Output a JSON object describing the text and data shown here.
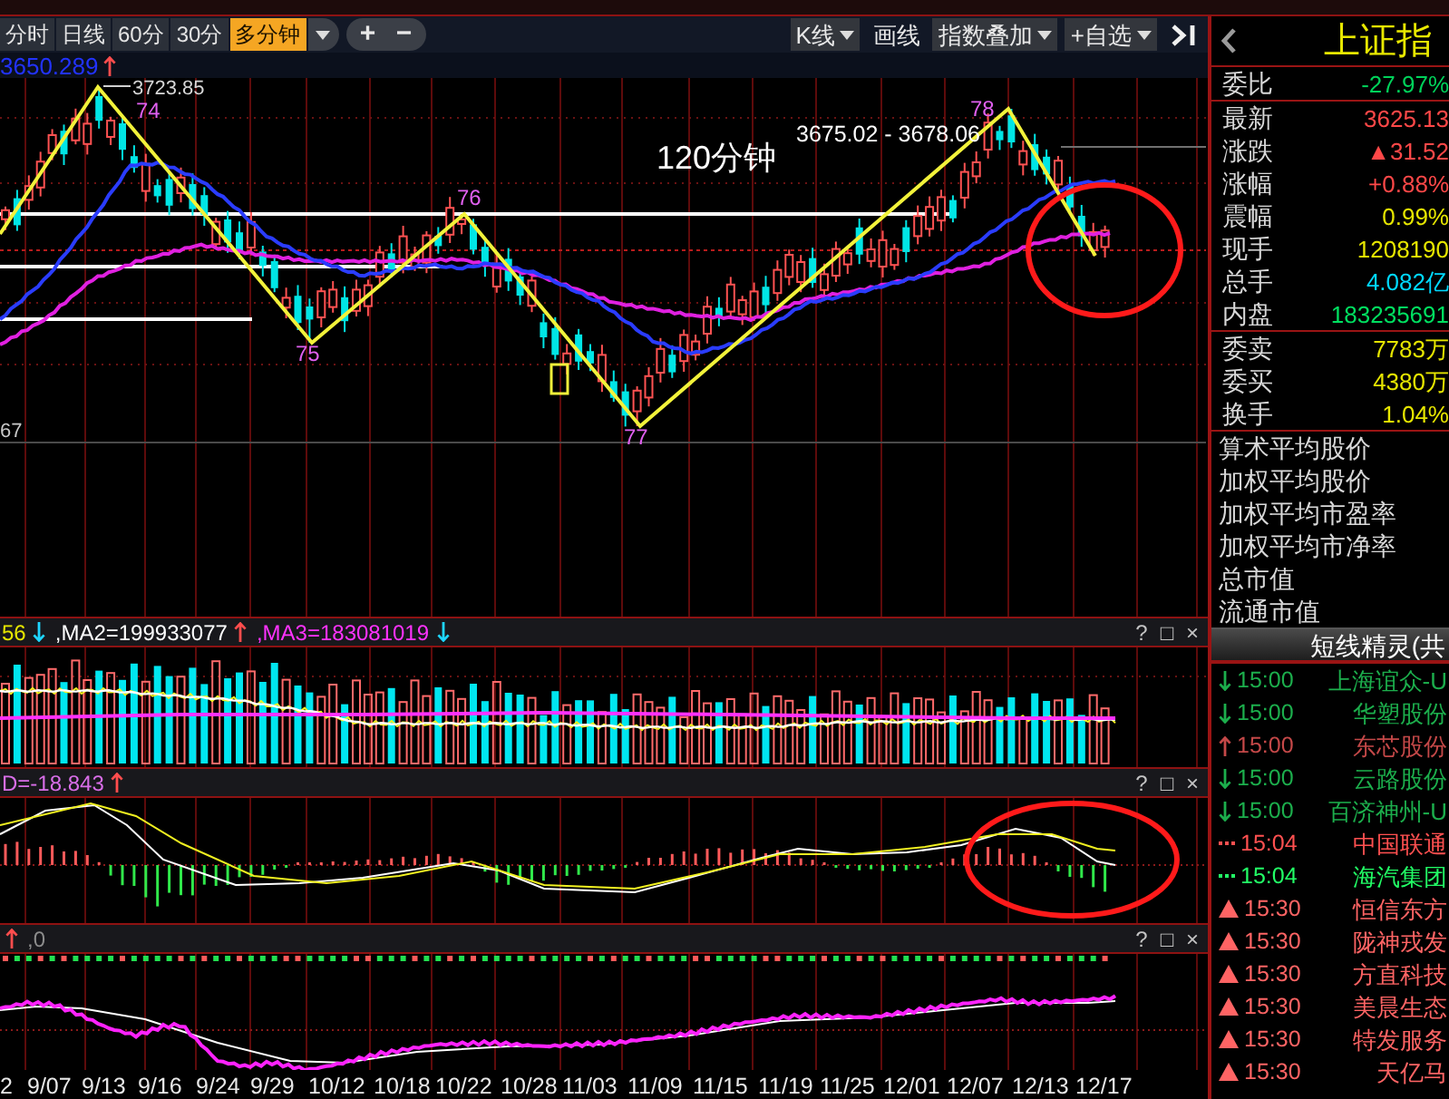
{
  "toolbar": {
    "periods": [
      {
        "label": "分时",
        "selected": false
      },
      {
        "label": "日线",
        "selected": false
      },
      {
        "label": "60分",
        "selected": false
      },
      {
        "label": "30分",
        "selected": false
      },
      {
        "label": "多分钟",
        "selected": true
      }
    ],
    "zoom_buttons": [
      "+",
      "−"
    ],
    "tools": [
      {
        "label": "K线",
        "kind": "dropdown"
      },
      {
        "label": "画线",
        "kind": "plain"
      },
      {
        "label": "指数叠加",
        "kind": "dropdown"
      },
      {
        "label": "+自选",
        "kind": "dropdown"
      }
    ]
  },
  "main_chart": {
    "reading": "3650.289",
    "high_label": "3723.85",
    "wave_labels": [
      "74",
      "75",
      "76",
      "77",
      "78"
    ],
    "period_label": "120分钟",
    "range_label": "3675.02 - 3678.06",
    "axis_label": "67"
  },
  "panels": [
    {
      "legend": [
        {
          "text": "56",
          "color": "#e6e600",
          "rising": false
        },
        {
          "text": ",MA2=199933077",
          "color": "#ffffff",
          "rising": true
        },
        {
          "text": ",MA3=183081019",
          "color": "#ff33ff",
          "rising": false
        }
      ],
      "buttons": [
        "?",
        "□",
        "×"
      ]
    },
    {
      "legend": [
        {
          "text": "D=-18.843",
          "color": "#d86ee8",
          "rising": true
        }
      ],
      "buttons": [
        "?",
        "□",
        "×"
      ]
    },
    {
      "legend": [
        {
          "rising": true
        },
        {
          "text": ",0",
          "color": "#8c8c8c"
        }
      ],
      "buttons": [
        "?",
        "□",
        "×"
      ]
    }
  ],
  "x_axis": [
    "2",
    "9/07",
    "9/13",
    "9/16",
    "9/24",
    "9/29",
    "10/12",
    "10/18",
    "10/22",
    "10/28",
    "11/03",
    "11/09",
    "11/15",
    "11/19",
    "11/25",
    "12/01",
    "12/07",
    "12/13",
    "12/17"
  ],
  "quote": {
    "title": "上证指",
    "groups": [
      {
        "rows": [
          {
            "label": "委比",
            "value": "-27.97%",
            "color": "#00d25a"
          }
        ]
      },
      {
        "rows": [
          {
            "label": "最新",
            "value": "3625.13",
            "color": "#ff4848"
          },
          {
            "label": "涨跌",
            "value": "▲31.52",
            "color": "#ff4848"
          },
          {
            "label": "涨幅",
            "value": "+0.88%",
            "color": "#ff4848"
          },
          {
            "label": "震幅",
            "value": "0.99%",
            "color": "#e6e600"
          },
          {
            "label": "现手",
            "value": "1208190",
            "color": "#e6e600"
          },
          {
            "label": "总手",
            "value": "4.082亿",
            "color": "#00d8ff"
          },
          {
            "label": "内盘",
            "value": "183235691",
            "color": "#00e060"
          }
        ]
      },
      {
        "rows": [
          {
            "label": "委卖",
            "value": "7783万",
            "color": "#e6e600"
          },
          {
            "label": "委买",
            "value": "4380万",
            "color": "#e6e600"
          },
          {
            "label": "换手",
            "value": "1.04%",
            "color": "#e6e600"
          }
        ]
      }
    ],
    "stats": [
      "算术平均股价",
      "加权平均股价",
      "加权平均市盈率",
      "加权平均市净率",
      "总市值",
      "流通市值"
    ]
  },
  "signals": {
    "title": "短线精灵(共",
    "rows": [
      {
        "kind": "down",
        "time": "15:00",
        "name": "上海谊众-U",
        "color": "#1cae4c"
      },
      {
        "kind": "down",
        "time": "15:00",
        "name": "华塑股份",
        "color": "#1cae4c"
      },
      {
        "kind": "up",
        "time": "15:00",
        "name": "东芯股份",
        "color": "#c44848"
      },
      {
        "kind": "down",
        "time": "15:00",
        "name": "云路股份",
        "color": "#1cae4c"
      },
      {
        "kind": "down",
        "time": "15:00",
        "name": "百济神州-U",
        "color": "#1cae4c"
      },
      {
        "kind": "dots",
        "time": "15:04",
        "name": "中国联通",
        "color": "#ff5050"
      },
      {
        "kind": "dots",
        "time": "15:04",
        "name": "海汽集团",
        "color": "#22ff66"
      },
      {
        "kind": "triangle",
        "time": "15:30",
        "name": "恒信东方",
        "color": "#ff6464"
      },
      {
        "kind": "triangle",
        "time": "15:30",
        "name": "陇神戎发",
        "color": "#ff6464"
      },
      {
        "kind": "triangle",
        "time": "15:30",
        "name": "方直科技",
        "color": "#ff6464"
      },
      {
        "kind": "triangle",
        "time": "15:30",
        "name": "美晨生态",
        "color": "#ff6464"
      },
      {
        "kind": "triangle",
        "time": "15:30",
        "name": "特发服务",
        "color": "#ff6464"
      },
      {
        "kind": "triangle",
        "time": "15:30",
        "name": "天亿马",
        "color": "#ff6464"
      }
    ]
  }
}
